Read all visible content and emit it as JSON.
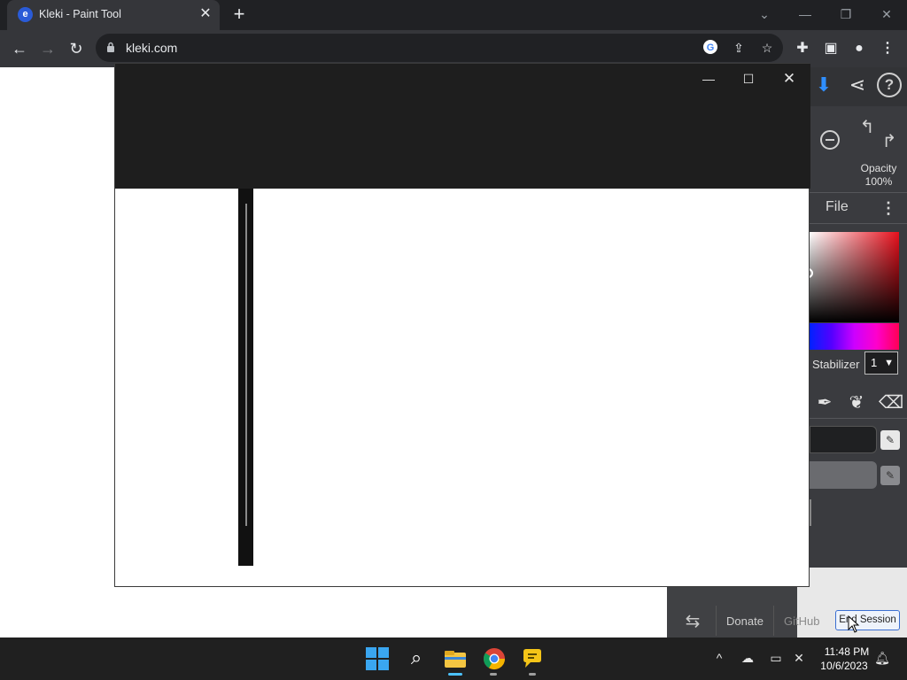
{
  "browser": {
    "tab": {
      "title": "Kleki - Paint Tool",
      "favicon_letter": "e"
    },
    "omnibox": {
      "url": "kleki.com"
    },
    "icons": {
      "back": "arrow-left-icon",
      "forward": "arrow-right-icon",
      "reload": "reload-icon",
      "lock": "lock-icon",
      "google": "google-icon",
      "share": "share-icon",
      "bookmark": "star-icon",
      "extensions": "puzzle-icon",
      "sidepanel": "side-panel-icon",
      "profile": "profile-icon",
      "menu": "kebab-menu-icon"
    }
  },
  "kleki": {
    "opacity_label": "Opacity",
    "opacity_value": "100%",
    "file_tab": "File",
    "stabilizer_label": "Stabilizer",
    "stabilizer_value": "1",
    "bottom_links": {
      "donate": "Donate",
      "github": "GitHub",
      "end_session": "End Session"
    },
    "accent_color": "#2f8fff"
  },
  "taskbar": {
    "time": "11:48 PM",
    "date": "10/6/2023"
  }
}
